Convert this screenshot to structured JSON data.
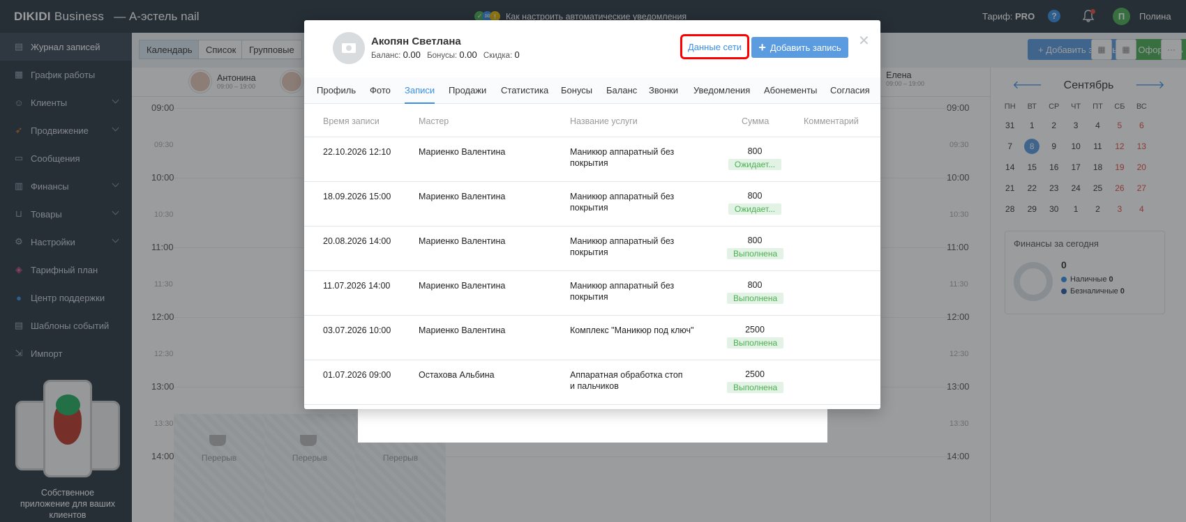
{
  "header": {
    "brand_main": "DIKIDI",
    "brand_sub": "Business",
    "salon": "—  А-эстель nail",
    "notice": "Как настроить автоматические уведомления",
    "tariff_label": "Тариф:",
    "tariff_value": "PRO",
    "help": "?",
    "avatar_letter": "П",
    "user_name": "Полина"
  },
  "sidebar": {
    "items": [
      {
        "label": "Журнал записей",
        "icon": "book-icon"
      },
      {
        "label": "График работы",
        "icon": "calendar-icon"
      },
      {
        "label": "Клиенты",
        "icon": "users-icon"
      },
      {
        "label": "Продвижение",
        "icon": "rocket-icon"
      },
      {
        "label": "Сообщения",
        "icon": "chat-icon"
      },
      {
        "label": "Финансы",
        "icon": "money-icon"
      },
      {
        "label": "Товары",
        "icon": "cart-icon"
      },
      {
        "label": "Настройки",
        "icon": "gear-icon"
      },
      {
        "label": "Тарифный план",
        "icon": "layers-icon"
      },
      {
        "label": "Центр поддержки",
        "icon": "help-icon"
      },
      {
        "label": "Шаблоны событий",
        "icon": "template-icon"
      },
      {
        "label": "Импорт",
        "icon": "import-icon"
      }
    ],
    "promo_text": "Собственное приложение для ваших клиентов"
  },
  "toolbar": {
    "view_calendar": "Календарь",
    "view_list": "Список",
    "view_group": "Групповые",
    "add_record": "+ Добавить запись",
    "make_sale": "Оформить продажу",
    "more": "···"
  },
  "calendar": {
    "masters": [
      {
        "name": "Антонина",
        "time": "09:00 – 19:00"
      },
      {
        "name": "Елена",
        "time": "09:00 – 19:00"
      }
    ],
    "times": [
      "09:00",
      "09:30",
      "10:00",
      "10:30",
      "11:00",
      "11:30",
      "12:00",
      "12:30",
      "13:00",
      "13:30",
      "14:00"
    ],
    "break_label": "Перерыв"
  },
  "mini_calendar": {
    "month": "Сентябрь",
    "prev": "🡐",
    "next": "🡒",
    "weekdays": [
      "ПН",
      "ВТ",
      "СР",
      "ЧТ",
      "ПТ",
      "СБ",
      "ВС"
    ],
    "weeks": [
      [
        "31",
        "1",
        "2",
        "3",
        "4",
        "5",
        "6"
      ],
      [
        "7",
        "8",
        "9",
        "10",
        "11",
        "12",
        "13"
      ],
      [
        "14",
        "15",
        "16",
        "17",
        "18",
        "19",
        "20"
      ],
      [
        "21",
        "22",
        "23",
        "24",
        "25",
        "26",
        "27"
      ],
      [
        "28",
        "29",
        "30",
        "1",
        "2",
        "3",
        "4"
      ]
    ],
    "today": "8"
  },
  "finance": {
    "title": "Финансы за сегодня",
    "total": "0",
    "cash_label": "Наличные",
    "cash_value": "0",
    "card_label": "Безналичные",
    "card_value": "0",
    "cash_color": "#3a8ee6",
    "card_color": "#2c5aa0"
  },
  "modal": {
    "client_name": "Акопян Светлана",
    "balance_label": "Баланс:",
    "balance_value": "0.00",
    "bonus_label": "Бонусы:",
    "bonus_value": "0.00",
    "discount_label": "Скидка:",
    "discount_value": "0",
    "network_button": "Данные сети",
    "add_button": "Добавить запись",
    "close": "✕",
    "tabs": [
      "Профиль",
      "Фото",
      "Записи",
      "Продажи",
      "Статистика",
      "Бонусы",
      "Баланс",
      "Звонки",
      "Уведомления",
      "Абонементы",
      "Согласия"
    ],
    "active_tab": "Записи",
    "columns": {
      "time": "Время записи",
      "master": "Мастер",
      "service": "Название услуги",
      "sum": "Сумма",
      "comment": "Комментарий"
    },
    "rows": [
      {
        "time": "22.10.2026 12:10",
        "master": "Мариенко Валентина",
        "service": "Маникюр аппаратный без покрытия",
        "sum": "800",
        "status": "Ожидает..."
      },
      {
        "time": "18.09.2026 15:00",
        "master": "Мариенко Валентина",
        "service": "Маникюр аппаратный без покрытия",
        "sum": "800",
        "status": "Ожидает..."
      },
      {
        "time": "20.08.2026 14:00",
        "master": "Мариенко Валентина",
        "service": "Маникюр аппаратный без покрытия",
        "sum": "800",
        "status": "Выполнена"
      },
      {
        "time": "11.07.2026 14:00",
        "master": "Мариенко Валентина",
        "service": "Маникюр аппаратный без покрытия",
        "sum": "800",
        "status": "Выполнена"
      },
      {
        "time": "03.07.2026 10:00",
        "master": "Мариенко Валентина",
        "service": "Комплекс \"Маникюр под ключ\"",
        "sum": "2500",
        "status": "Выполнена"
      },
      {
        "time": "01.07.2026 09:00",
        "master": "Остахова Альбина",
        "service": "Аппаратная обработка стоп и пальчиков",
        "sum": "2500",
        "status": "Выполнена"
      }
    ]
  }
}
